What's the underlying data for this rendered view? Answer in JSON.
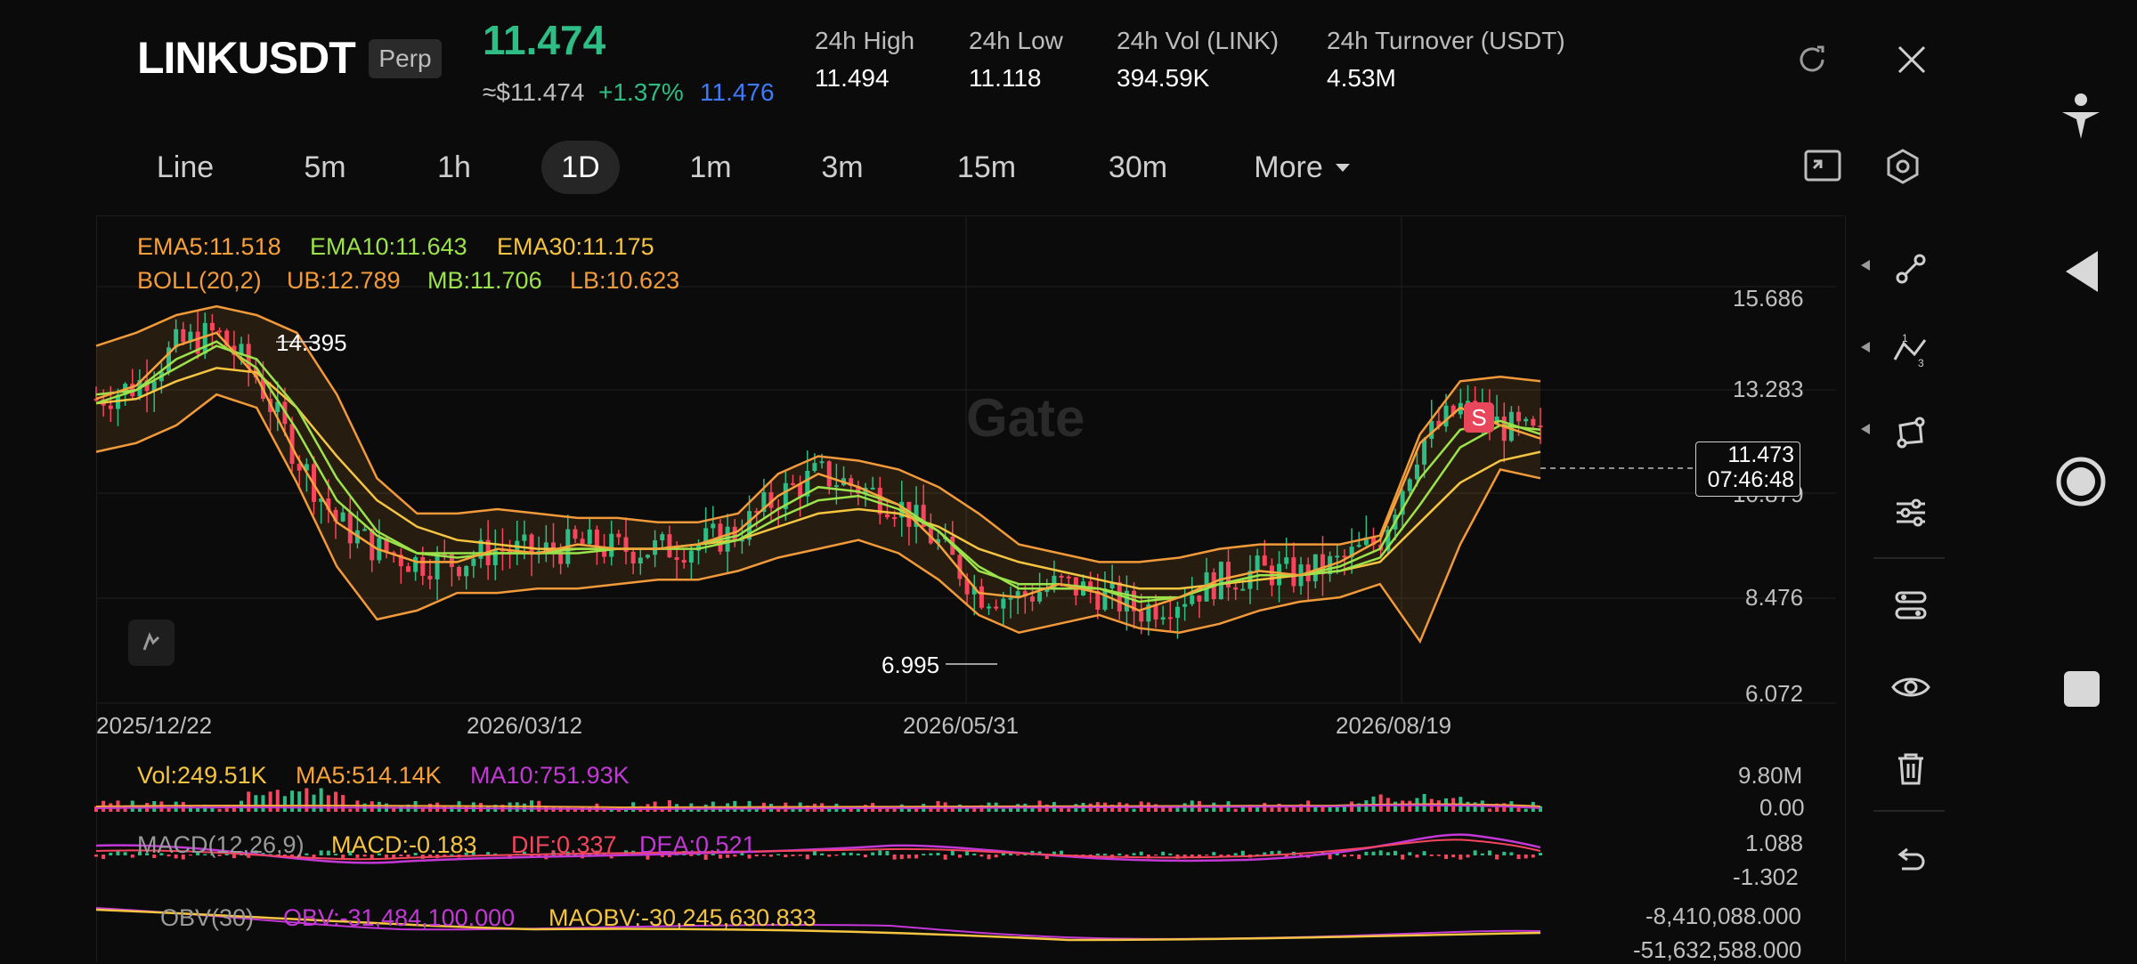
{
  "header": {
    "symbol": "LINKUSDT",
    "badge": "Perp",
    "last_price": "11.474",
    "approx_price": "≈$11.474",
    "change_pct": "+1.37%",
    "mark_price": "11.476",
    "stats": [
      {
        "label": "24h   High",
        "value": "11.494"
      },
      {
        "label": "24h   Low",
        "value": "11.118"
      },
      {
        "label": "24h   Vol (LINK)",
        "value": "394.59K"
      },
      {
        "label": "24h   Turnover (USDT)",
        "value": "4.53M"
      }
    ],
    "refresh_icon": "refresh-icon",
    "close_icon": "close-icon"
  },
  "timeframes": {
    "items": [
      "Line",
      "5m",
      "1h",
      "1D",
      "1m",
      "3m",
      "15m",
      "30m",
      "More"
    ],
    "active": "1D",
    "more_icon": "caret-down-icon",
    "fullscreen_icon": "fullscreen-icon",
    "settings_icon": "hexagon-settings-icon"
  },
  "indicators": {
    "ema5": "EMA5:11.518",
    "ema10": "EMA10:11.643",
    "ema30": "EMA30:11.175",
    "boll": "BOLL(20,2)",
    "ub": "UB:12.789",
    "mb": "MB:11.706",
    "lb": "LB:10.623",
    "vol": "Vol:249.51K",
    "ma5": "MA5:514.14K",
    "ma10": "MA10:751.93K",
    "macd_title": "MACD(12,26,9)",
    "macd_val": "MACD:-0.183",
    "dif": "DIF:0.337",
    "dea": "DEA:0.521",
    "obv_title": "OBV(30)",
    "obv_val": "OBV:-31,484,100.000",
    "maobv": "MAOBV:-30,245,630.833"
  },
  "colors": {
    "up": "#2ebd85",
    "down": "#f6465d",
    "ema5": "#f7a23b",
    "ema10": "#9be24b",
    "ema30": "#f5c542",
    "boll": "#f29a3a",
    "macd_purple": "#c338d6",
    "accent_blue": "#3d7bfd"
  },
  "watermark": "Gate",
  "chart_data": [
    {
      "type": "line",
      "title": "",
      "x_ticks": [
        "2025/12/22",
        "2026/03/12",
        "2026/05/31",
        "2026/08/19"
      ],
      "y_ticks": [
        "15.686",
        "13.283",
        "8.476",
        "6.072"
      ],
      "ylim": [
        6.072,
        15.686
      ],
      "current_price_label": "11.473",
      "countdown": "07:46:48",
      "hidden_tick": "10.879",
      "high_marker": "14.395",
      "low_marker": "6.995",
      "signal_badge": "S",
      "series": [
        {
          "name": "EMA5",
          "values": [
            12.4,
            12.7,
            13.6,
            13.9,
            12.9,
            11.1,
            9.6,
            9.0,
            8.7,
            8.7,
            9.0,
            8.9,
            9.1,
            9.0,
            9.0,
            9.1,
            9.4,
            10.2,
            10.7,
            10.4,
            10.0,
            9.1,
            8.0,
            7.9,
            8.2,
            8.0,
            7.6,
            7.9,
            8.3,
            8.5,
            8.4,
            8.7,
            9.2,
            11.4,
            12.2,
            11.8,
            11.5
          ]
        },
        {
          "name": "EMA10",
          "values": [
            12.5,
            12.6,
            13.3,
            13.7,
            13.1,
            11.7,
            10.1,
            9.3,
            8.9,
            8.8,
            8.9,
            8.9,
            9.0,
            9.0,
            9.0,
            9.1,
            9.3,
            9.9,
            10.4,
            10.3,
            10.0,
            9.4,
            8.5,
            8.2,
            8.2,
            8.1,
            7.8,
            7.9,
            8.2,
            8.4,
            8.4,
            8.6,
            9.0,
            10.6,
            11.7,
            11.9,
            11.6
          ]
        },
        {
          "name": "EMA30",
          "values": [
            12.3,
            12.4,
            12.8,
            13.1,
            13.0,
            12.2,
            11.1,
            10.1,
            9.5,
            9.2,
            9.1,
            9.0,
            9.0,
            9.0,
            9.0,
            9.1,
            9.2,
            9.5,
            9.8,
            9.9,
            9.8,
            9.5,
            9.0,
            8.7,
            8.5,
            8.3,
            8.1,
            8.1,
            8.2,
            8.3,
            8.4,
            8.5,
            8.7,
            9.6,
            10.5,
            11.0,
            11.2
          ]
        },
        {
          "name": "UB",
          "values": [
            13.6,
            13.9,
            14.3,
            14.5,
            14.3,
            13.9,
            12.5,
            10.6,
            9.8,
            9.8,
            9.9,
            9.8,
            9.7,
            9.7,
            9.6,
            9.6,
            9.8,
            10.7,
            11.1,
            11.0,
            10.8,
            10.4,
            9.8,
            9.1,
            8.9,
            8.7,
            8.7,
            8.8,
            9.0,
            9.1,
            9.1,
            9.1,
            9.3,
            11.6,
            12.8,
            12.9,
            12.8
          ]
        },
        {
          "name": "MB",
          "values": [
            12.3,
            12.6,
            13.1,
            13.6,
            13.3,
            12.2,
            10.6,
            9.4,
            8.9,
            8.9,
            8.9,
            8.9,
            8.9,
            9.0,
            9.0,
            9.0,
            9.2,
            9.7,
            10.1,
            10.2,
            9.9,
            9.4,
            8.6,
            8.1,
            8.1,
            8.1,
            7.9,
            7.9,
            8.2,
            8.4,
            8.4,
            8.5,
            8.8,
            10.0,
            11.3,
            11.8,
            11.7
          ]
        },
        {
          "name": "LB",
          "values": [
            11.2,
            11.4,
            11.8,
            12.5,
            12.2,
            10.5,
            8.6,
            7.4,
            7.6,
            8.0,
            8.0,
            8.1,
            8.1,
            8.2,
            8.3,
            8.3,
            8.5,
            8.8,
            9.0,
            9.2,
            8.9,
            8.3,
            7.5,
            7.1,
            7.3,
            7.5,
            7.2,
            7.1,
            7.3,
            7.6,
            7.8,
            7.9,
            8.2,
            6.9,
            9.1,
            10.8,
            10.6
          ]
        }
      ]
    },
    {
      "type": "bar",
      "title": "Volume",
      "y_ticks": [
        "9.80M",
        "0.00"
      ]
    },
    {
      "type": "line",
      "title": "MACD",
      "y_ticks": [
        "1.088",
        "-1.302"
      ]
    },
    {
      "type": "line",
      "title": "OBV",
      "y_ticks": [
        "-8,410,088.000",
        "-51,632,588.000"
      ]
    }
  ],
  "toolbar": [
    "trend-line-icon",
    "fibonacci-icon",
    "shape-icon",
    "indicator-settings-icon",
    "layout-icon",
    "visibility-eye-icon",
    "trash-icon",
    "undo-icon"
  ],
  "system_nav": [
    "accessibility-icon",
    "back-triangle-icon",
    "home-circle-icon",
    "recents-square-icon"
  ]
}
